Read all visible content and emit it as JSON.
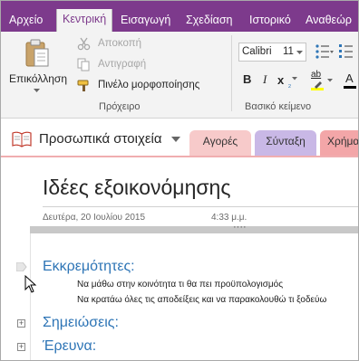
{
  "ribbon_tabs": {
    "file": "Αρχείο",
    "home": "Κεντρική",
    "insert": "Εισαγωγή",
    "draw": "Σχεδίαση",
    "history": "Ιστορικό",
    "review": "Αναθεώρ"
  },
  "clipboard": {
    "paste_label": "Επικόλληση",
    "cut_label": "Αποκοπή",
    "copy_label": "Αντιγραφή",
    "format_painter_label": "Πινέλο μορφοποίησης",
    "group_label": "Πρόχειρο"
  },
  "basic_text": {
    "font_name": "Calibri",
    "font_size": "11",
    "bold": "B",
    "italic": "I",
    "subscript": "x",
    "subscript_mark": "₂",
    "highlight": "ab",
    "font_color": "A",
    "group_label": "Βασικό κείμενο"
  },
  "notebook": {
    "name": "Προσωπικά στοιχεία"
  },
  "section_tabs": [
    {
      "label": "Αγορές",
      "color": "#f7caca"
    },
    {
      "label": "Σύνταξη",
      "color": "#c9b8e6"
    },
    {
      "label": "Χρήμα",
      "color": "#f3a6a8"
    }
  ],
  "page": {
    "title": "Ιδέες εξοικονόμησης",
    "date": "Δευτέρα, 20 Ιουλίου 2015",
    "time": "4:33 μ.μ.",
    "outline_handle": "····",
    "headings": {
      "pending": "Εκκρεμότητες:",
      "notes": "Σημειώσεις:",
      "research": "Έρευνα:"
    },
    "todo_items": [
      "Να μάθω στην κοινότητα τι θα πει προϋπολογισμός",
      "Να κρατάω όλες τις αποδείξεις και να παρακολουθώ τι ξοδεύω"
    ],
    "expand_symbol": "+"
  },
  "colors": {
    "accent": "#7d3a8c",
    "heading_blue": "#2e75b6",
    "page_border": "#f0aeb0"
  }
}
